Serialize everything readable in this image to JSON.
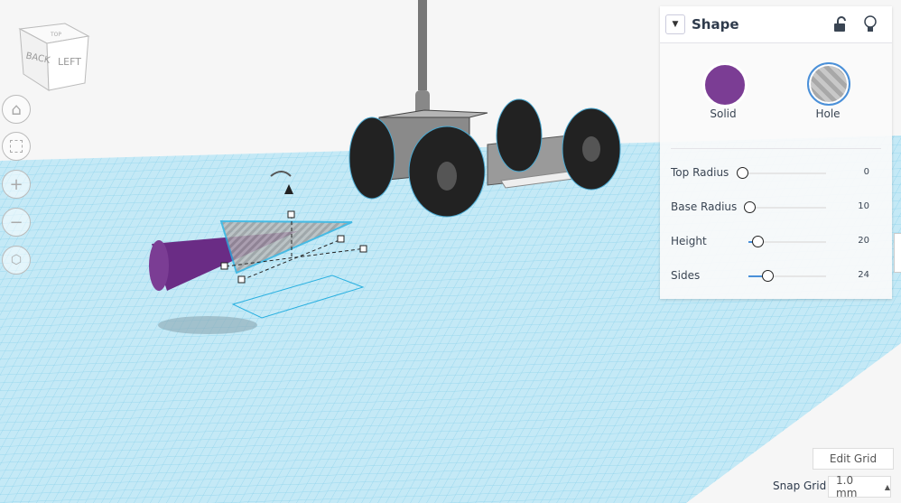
{
  "viewcube": {
    "faces": [
      "BACK",
      "LEFT",
      "TOP"
    ]
  },
  "nav_buttons": [
    {
      "name": "home-view-button",
      "icon": "home-icon"
    },
    {
      "name": "fit-view-button",
      "icon": "fit-icon"
    },
    {
      "name": "zoom-in-button",
      "icon": "plus-icon",
      "glyph": "+"
    },
    {
      "name": "zoom-out-button",
      "icon": "minus-icon",
      "glyph": "−"
    },
    {
      "name": "perspective-button",
      "icon": "perspective-cube-icon"
    }
  ],
  "shape_panel": {
    "title": "Shape",
    "solid_label": "Solid",
    "hole_label": "Hole",
    "solid_color": "#7b3d94",
    "params": [
      {
        "label": "Top Radius",
        "value": "0",
        "fraction": 0.0
      },
      {
        "label": "Base Radius",
        "value": "10",
        "fraction": 0.1
      },
      {
        "label": "Height",
        "value": "20",
        "fraction": 0.2
      },
      {
        "label": "Sides",
        "value": "24",
        "fraction": 0.33
      }
    ]
  },
  "grid": {
    "edit_label": "Edit Grid",
    "snap_label": "Snap Grid",
    "snap_value": "1.0 mm",
    "snap_arrow": "▲"
  },
  "colors": {
    "workplane": "#bfe6f4",
    "gridline": "#7ccbe6",
    "accent": "#4a90d9",
    "selection": "#2ab0e0"
  }
}
